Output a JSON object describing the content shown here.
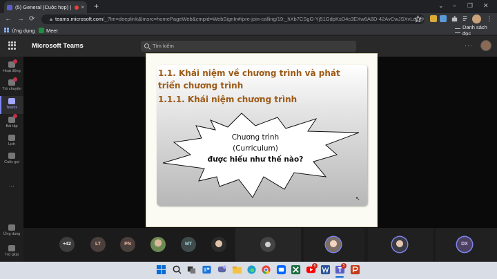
{
  "browser": {
    "tab_title": "(5) General (Cuộc họp) | Mic",
    "tab_close": "×",
    "new_tab": "+",
    "window_controls": [
      "⌄",
      "–",
      "❐",
      "✕"
    ],
    "nav": {
      "back": "←",
      "forward": "→",
      "reload": "⟳"
    },
    "url_host": "teams.microsoft.com",
    "url_path": "/_?lm=deeplink&lmsrc=homePageWeb&cmpid=WebSignIn#/pre-join-calling/19:_hXb7CSgG-Yj51GdpKsD4c3EXw6A8D-42AvCwJSXvLo1@thr...",
    "bookmarks": {
      "apps": "Ứng dụng",
      "meet": "Meet",
      "reading_list": "Danh sách đọc"
    }
  },
  "teams": {
    "app_title": "Microsoft Teams",
    "search_placeholder": "Tìm kiếm",
    "more": "···",
    "rail": [
      {
        "label": "Hoạt động",
        "icon": "bell-icon"
      },
      {
        "label": "Trò chuyện",
        "icon": "chat-icon"
      },
      {
        "label": "Teams",
        "icon": "teams-icon"
      },
      {
        "label": "Bài tập",
        "icon": "assignments-icon"
      },
      {
        "label": "Lịch",
        "icon": "calendar-icon"
      },
      {
        "label": "Cuộc gọi",
        "icon": "phone-icon"
      },
      {
        "label": "...",
        "icon": "more-icon"
      },
      {
        "label": "Ứng dụng",
        "icon": "apps-icon"
      },
      {
        "label": "Trợ giúp",
        "icon": "help-icon"
      }
    ],
    "active_rail": "Teams"
  },
  "slide": {
    "heading_1": "1.1. Khái niệm về chương trình và phát triển chương trình",
    "heading_2": "1.1.1. Khái niệm chương trình",
    "callout_line_1": "Chương trình",
    "callout_line_2": "(Curriculum)",
    "callout_line_3": "được hiểu như thế nào?"
  },
  "participants": {
    "overflow": "+42",
    "initials": [
      "LT",
      "PN",
      "MT",
      "DX"
    ],
    "colors": {
      "overflow": "#3d3d3d",
      "LT": "#4a3f3c",
      "PN": "#4a3f3c",
      "MT": "#3f4a4b",
      "DX": "#4c4060",
      "accent": "#7f85f5"
    }
  },
  "taskbar": {
    "icons": [
      "windows-start-icon",
      "search-icon",
      "task-view-icon",
      "widgets-icon",
      "teams-chat-icon",
      "file-explorer-icon",
      "edge-icon",
      "chrome-icon",
      "zalo-icon",
      "excel-icon",
      "youtube-icon",
      "word-icon",
      "teams-icon",
      "powerpoint-icon"
    ],
    "badges": {
      "youtube": "6",
      "teams": "5"
    }
  }
}
